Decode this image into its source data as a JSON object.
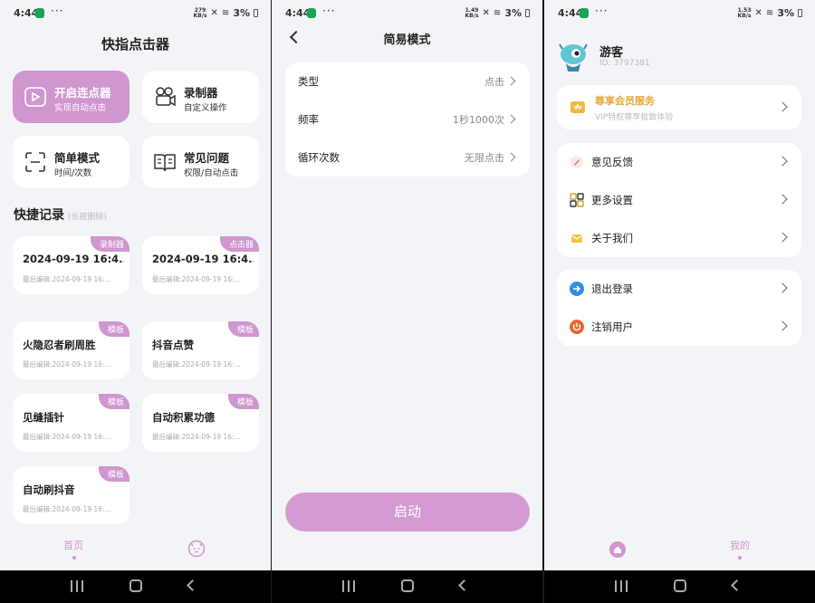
{
  "status": {
    "time": "4:44",
    "dots": "···",
    "battery": "3%",
    "speed1": "279\nKB/s",
    "speed2": "1.49\nKB/s",
    "speed3": "1.53\nKB/s"
  },
  "home": {
    "title": "快指点击器",
    "features": [
      {
        "title": "开启连点器",
        "sub": "实现自动点击"
      },
      {
        "title": "录制器",
        "sub": "自定义操作"
      },
      {
        "title": "简单模式",
        "sub": "时间/次数"
      },
      {
        "title": "常见问题",
        "sub": "权限/自动点击"
      }
    ],
    "records_title": "快捷记录",
    "records_hint": "(长按删除)",
    "records": [
      {
        "name": "2024-09-19 16:4...",
        "edited": "最后编辑:2024-09-19 16:...",
        "tag": "录制器"
      },
      {
        "name": "2024-09-19 16:4...",
        "edited": "最后编辑:2024-09-19 16:...",
        "tag": "点击器"
      },
      {
        "name": "火隐忍者刷周胜",
        "edited": "最后编辑:2024-09-19 16:...",
        "tag": "模板"
      },
      {
        "name": "抖音点赞",
        "edited": "最后编辑:2024-09-19 16:...",
        "tag": "模板"
      },
      {
        "name": "见缝插针",
        "edited": "最后编辑:2024-09-19 16:...",
        "tag": "模板"
      },
      {
        "name": "自动积累功德",
        "edited": "最后编辑:2024-09-19 16:...",
        "tag": "模板"
      },
      {
        "name": "自动刷抖音",
        "edited": "最后编辑:2024-09-19 16:...",
        "tag": "模板"
      }
    ],
    "tab_home": "首页"
  },
  "simple": {
    "title": "简易模式",
    "rows": [
      {
        "label": "类型",
        "value": "点击"
      },
      {
        "label": "频率",
        "value": "1秒1000次"
      },
      {
        "label": "循环次数",
        "value": "无限点击"
      }
    ],
    "start": "启动"
  },
  "me": {
    "username": "游客",
    "user_id": "ID: 3797381",
    "vip_title": "尊享会员服务",
    "vip_sub": "VIP特权尊享极致体验",
    "group1": [
      "意见反馈",
      "更多设置",
      "关于我们"
    ],
    "group2": [
      "退出登录",
      "注销用户"
    ],
    "tab_me": "我的"
  },
  "colors": {
    "accent": "#cf96cf",
    "vip_gold": "#e6a83c"
  }
}
